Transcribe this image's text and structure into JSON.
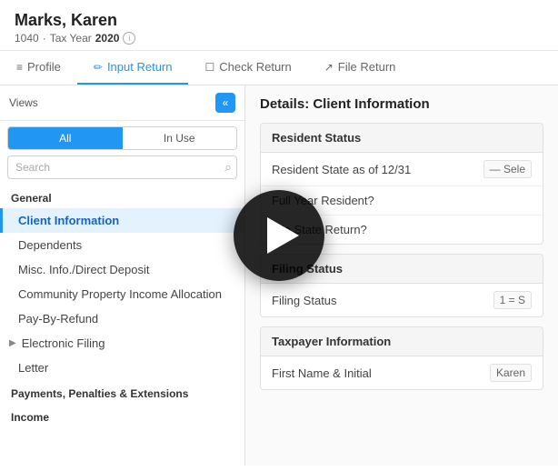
{
  "header": {
    "name": "Marks, Karen",
    "form": "1040",
    "separator": "·",
    "tax_year_label": "Tax Year",
    "tax_year": "2020"
  },
  "tabs": [
    {
      "id": "profile",
      "label": "Profile",
      "icon": "≡",
      "active": false
    },
    {
      "id": "input-return",
      "label": "Input Return",
      "icon": "✏",
      "active": true
    },
    {
      "id": "check-return",
      "label": "Check Return",
      "icon": "☐",
      "active": false
    },
    {
      "id": "file-return",
      "label": "File Return",
      "icon": "↗",
      "active": false
    }
  ],
  "sidebar": {
    "views_label": "Views",
    "filter_tabs": [
      {
        "id": "all",
        "label": "All",
        "active": true
      },
      {
        "id": "in-use",
        "label": "In Use",
        "active": false
      }
    ],
    "search_placeholder": "Search",
    "nav": {
      "section_general": "General",
      "items_general": [
        {
          "id": "client-information",
          "label": "Client Information",
          "active": true,
          "indent": false
        },
        {
          "id": "dependents",
          "label": "Dependents",
          "active": false,
          "indent": true
        },
        {
          "id": "misc-info",
          "label": "Misc. Info./Direct Deposit",
          "active": false,
          "indent": true
        },
        {
          "id": "community-property",
          "label": "Community Property Income Allocation",
          "active": false,
          "indent": true
        },
        {
          "id": "pay-by-refund",
          "label": "Pay-By-Refund",
          "active": false,
          "indent": true
        },
        {
          "id": "electronic-filing",
          "label": "Electronic Filing",
          "active": false,
          "indent": false,
          "arrow": true
        },
        {
          "id": "letter",
          "label": "Letter",
          "active": false,
          "indent": true
        }
      ],
      "section_payments": "Payments, Penalties & Extensions",
      "section_income": "Income"
    }
  },
  "main": {
    "section_title": "Details: Client Information",
    "cards": [
      {
        "id": "resident-status",
        "header": "Resident Status",
        "rows": [
          {
            "label": "Resident State as of 12/31",
            "value": "— Sele"
          },
          {
            "label": "Full Year Resident?",
            "value": ""
          },
          {
            "label": "File State Return?",
            "value": ""
          }
        ]
      },
      {
        "id": "filing-status",
        "header": "Filing Status",
        "rows": [
          {
            "label": "Filing Status",
            "value": "1 = S"
          }
        ]
      },
      {
        "id": "taxpayer-information",
        "header": "Taxpayer Information",
        "rows": [
          {
            "label": "First Name & Initial",
            "value": "Karen"
          }
        ]
      }
    ]
  },
  "play_button": {
    "visible": true,
    "aria_label": "Play video"
  },
  "icons": {
    "collapse": "«",
    "search": "🔍",
    "info": "i"
  }
}
